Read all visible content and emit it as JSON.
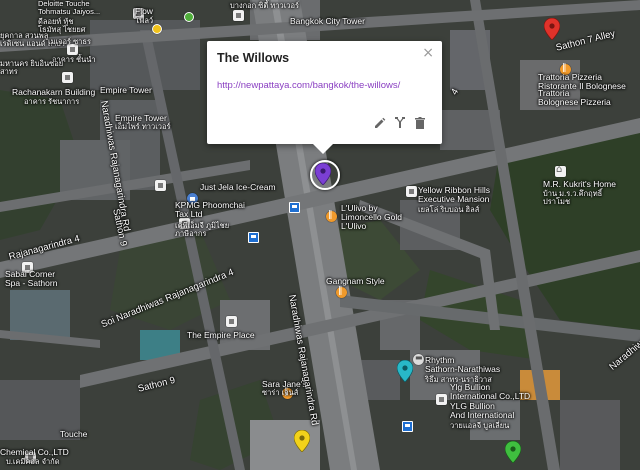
{
  "info_window": {
    "title": "The Willows",
    "link": "http://newpattaya.com/bangkok/the-willows/",
    "close_glyph": "×",
    "tools": [
      "edit-icon",
      "style-icon",
      "delete-icon"
    ]
  },
  "places": {
    "deloitte": "Deloitte Touche\nTohmatsu Jaiyos...",
    "deloitte_th": "ดีลอยท์ ทู้ช\nโธมัทสุ ไชยยศ",
    "thai_label_1": "ยุคกาล สวนพลู\nเรดิเซน แอนด์ สาธร",
    "thai_label_2": "เมเจอร์ ซาธร",
    "thai_label_3": "อาคาร ชั้นนำ",
    "thai_label_4": "มหานคร ยิบอินซอย\nสาทร",
    "rachanakarn": "Rachanakarn Building",
    "rachanakarn_th": "อาคาร รัชนาการ",
    "empire_tower_1": "Empire Tower",
    "empire_tower_2": "Empire Tower",
    "empire_tower_th": "เอ็มไพร์ ทาวเวอร์",
    "bangkok_city_tower": "Bangkok City Tower",
    "bangkok_city_tower_th": "บางกอก ซิตี้ ทาวเวอร์",
    "flow": "Flow",
    "flow_th": "โฟลว์",
    "just_jela": "Just Jela Ice-Cream",
    "kpmg": "KPMG Phoomchai\nTax Ltd",
    "kpmg_th": "เคพีเอ็มจี ภูมิไชย\nภาษีอากร",
    "sabai": "Sabai Corner\nSpa - Sathorn",
    "empire_place": "The Empire Place",
    "ulivo": "L'Ulivo by\nLimoncello Gold",
    "ulivo_2": "L'Ulivo",
    "gangnam": "Gangnam Style",
    "yellow_ribbon": "Yellow Ribbon Hills\nExecutive Mansion",
    "yellow_ribbon_th": "เยลโล่ ริบบอน ฮิลส์",
    "mr_kukrit": "M.R. Kukrit's Home",
    "mr_kukrit_th": "บ้าน ม.ร.ว.คึกฤทธิ์\nปราโมช",
    "trattoria": "Trattoria Pizzeria\nRistorante Il Bolognese",
    "trattoria_2": "Trattoria\nBolognese Pizzeria",
    "rhythm": "Rhythm\nSathorn-Narathiwas",
    "rhythm_th": "ริธึ่ม สาทร-นราธิวาส",
    "ylg": "Ylg Bullion\nInternational Co.,LTD",
    "ylg_2": "YLG Bullion\nAnd International",
    "ylg_th": "วายแอลจี บูลเลี่ยน",
    "sarajane": "Sara Jane's",
    "sarajane_th": "ซาร่า เจนส์",
    "chemical": "Chemical Co.,LTD",
    "chemical_th": "บ.เคมีคอล จำกัด",
    "touche": "Touche"
  },
  "roads": {
    "naradhiwas_north": "Naradhiwas Rajanagarindra Rd",
    "naradhiwas_south": "Naradhiwas Rajanagarindra Rd",
    "soi_naradhiwas": "Soi Naradhiwas Rajanagarindra 4",
    "rajanagarindra_4": "Rajanagarindra 4",
    "sathon_7": "Sathon 7 Alley",
    "sathon_9": "Sathon 9",
    "sathon_9b": "Sathon 9",
    "narathiwas_east": "Naradhiwas",
    "lane_4": "4"
  },
  "colors": {
    "marker_selected": "#7b3fd4",
    "marker_red": "#e0322a",
    "marker_cyan": "#28b8c8",
    "marker_yellow": "#f2d21a",
    "marker_green": "#3fbf3f",
    "link": "#8a3fc2"
  }
}
